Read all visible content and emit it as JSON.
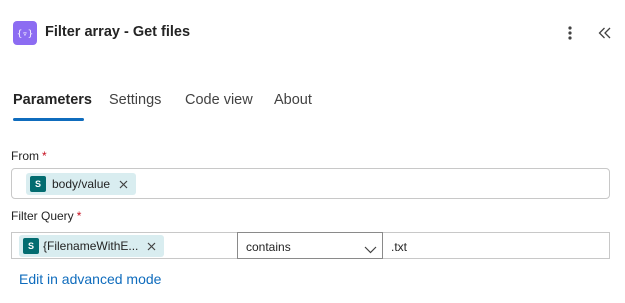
{
  "header": {
    "title": "Filter array - Get files",
    "action_icon": "filter-array-icon",
    "accent_color": "#8c6cf2"
  },
  "tabs": [
    {
      "label": "Parameters",
      "active": true
    },
    {
      "label": "Settings",
      "active": false
    },
    {
      "label": "Code view",
      "active": false
    },
    {
      "label": "About",
      "active": false
    }
  ],
  "from": {
    "label": "From",
    "required_mark": "*",
    "token": {
      "text": "body/value",
      "icon": "sharepoint-icon",
      "icon_letter": "S"
    }
  },
  "filter_query": {
    "label": "Filter Query",
    "required_mark": "*",
    "left_token": {
      "text": "{FilenameWithE...",
      "icon": "sharepoint-icon",
      "icon_letter": "S"
    },
    "operator": "contains",
    "right_value": ".txt"
  },
  "advanced_link": "Edit in advanced mode",
  "colors": {
    "link": "#0f6cbd",
    "token_bg": "#d9edf0",
    "sharepoint": "#036c70",
    "required": "#c50f1f"
  }
}
